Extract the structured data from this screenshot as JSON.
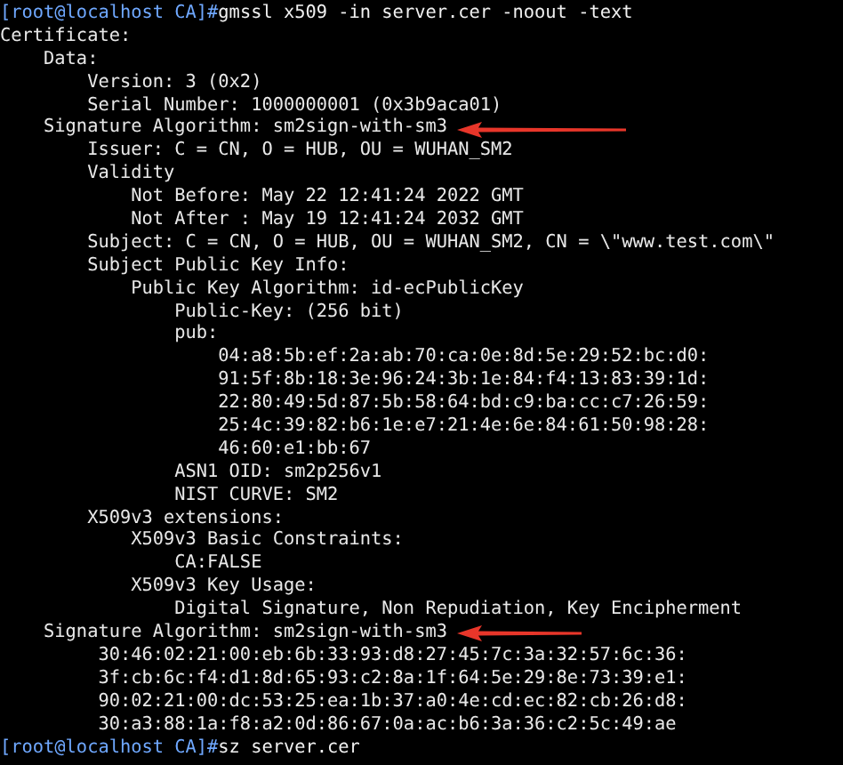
{
  "terminal": {
    "lines": [
      {
        "kind": "prompt",
        "prompt": "[root@localhost CA]#",
        "command": "gmssl x509 -in server.cer -noout -text"
      },
      {
        "kind": "output",
        "text": "Certificate:",
        "arrow": false
      },
      {
        "kind": "output",
        "text": "    Data:",
        "arrow": false
      },
      {
        "kind": "output",
        "text": "        Version: 3 (0x2)",
        "arrow": false
      },
      {
        "kind": "output",
        "text": "        Serial Number: 1000000001 (0x3b9aca01)",
        "arrow": false
      },
      {
        "kind": "output",
        "text": "    Signature Algorithm: sm2sign-with-sm3",
        "arrow": true
      },
      {
        "kind": "output",
        "text": "        Issuer: C = CN, O = HUB, OU = WUHAN_SM2",
        "arrow": false
      },
      {
        "kind": "output",
        "text": "        Validity",
        "arrow": false
      },
      {
        "kind": "output",
        "text": "            Not Before: May 22 12:41:24 2022 GMT",
        "arrow": false
      },
      {
        "kind": "output",
        "text": "            Not After : May 19 12:41:24 2032 GMT",
        "arrow": false
      },
      {
        "kind": "output",
        "text": "        Subject: C = CN, O = HUB, OU = WUHAN_SM2, CN = \\\"www.test.com\\\"",
        "arrow": false
      },
      {
        "kind": "output",
        "text": "        Subject Public Key Info:",
        "arrow": false
      },
      {
        "kind": "output",
        "text": "            Public Key Algorithm: id-ecPublicKey",
        "arrow": false
      },
      {
        "kind": "output",
        "text": "                Public-Key: (256 bit)",
        "arrow": false
      },
      {
        "kind": "output",
        "text": "                pub:",
        "arrow": false
      },
      {
        "kind": "output",
        "text": "                    04:a8:5b:ef:2a:ab:70:ca:0e:8d:5e:29:52:bc:d0:",
        "arrow": false
      },
      {
        "kind": "output",
        "text": "                    91:5f:8b:18:3e:96:24:3b:1e:84:f4:13:83:39:1d:",
        "arrow": false
      },
      {
        "kind": "output",
        "text": "                    22:80:49:5d:87:5b:58:64:bd:c9:ba:cc:c7:26:59:",
        "arrow": false
      },
      {
        "kind": "output",
        "text": "                    25:4c:39:82:b6:1e:e7:21:4e:6e:84:61:50:98:28:",
        "arrow": false
      },
      {
        "kind": "output",
        "text": "                    46:60:e1:bb:67",
        "arrow": false
      },
      {
        "kind": "output",
        "text": "                ASN1 OID: sm2p256v1",
        "arrow": false
      },
      {
        "kind": "output",
        "text": "                NIST CURVE: SM2",
        "arrow": false
      },
      {
        "kind": "output",
        "text": "        X509v3 extensions:",
        "arrow": false
      },
      {
        "kind": "output",
        "text": "            X509v3 Basic Constraints:",
        "arrow": false
      },
      {
        "kind": "output",
        "text": "                CA:FALSE",
        "arrow": false
      },
      {
        "kind": "output",
        "text": "            X509v3 Key Usage:",
        "arrow": false
      },
      {
        "kind": "output",
        "text": "                Digital Signature, Non Repudiation, Key Encipherment",
        "arrow": false
      },
      {
        "kind": "output",
        "text": "    Signature Algorithm: sm2sign-with-sm3",
        "arrow": true
      },
      {
        "kind": "output",
        "text": "         30:46:02:21:00:eb:6b:33:93:d8:27:45:7c:3a:32:57:6c:36:",
        "arrow": false
      },
      {
        "kind": "output",
        "text": "         3f:cb:6c:f4:d1:8d:65:93:c2:8a:1f:64:5e:29:8e:73:39:e1:",
        "arrow": false
      },
      {
        "kind": "output",
        "text": "         90:02:21:00:dc:53:25:ea:1b:37:a0:4e:cd:ec:82:cb:26:d8:",
        "arrow": false
      },
      {
        "kind": "output",
        "text": "         30:a3:88:1a:f8:a2:0d:86:67:0a:ac:b6:3a:36:c2:5c:49:ae",
        "arrow": false
      },
      {
        "kind": "prompt",
        "prompt": "[root@localhost CA]#",
        "command": "sz server.cer"
      }
    ]
  }
}
